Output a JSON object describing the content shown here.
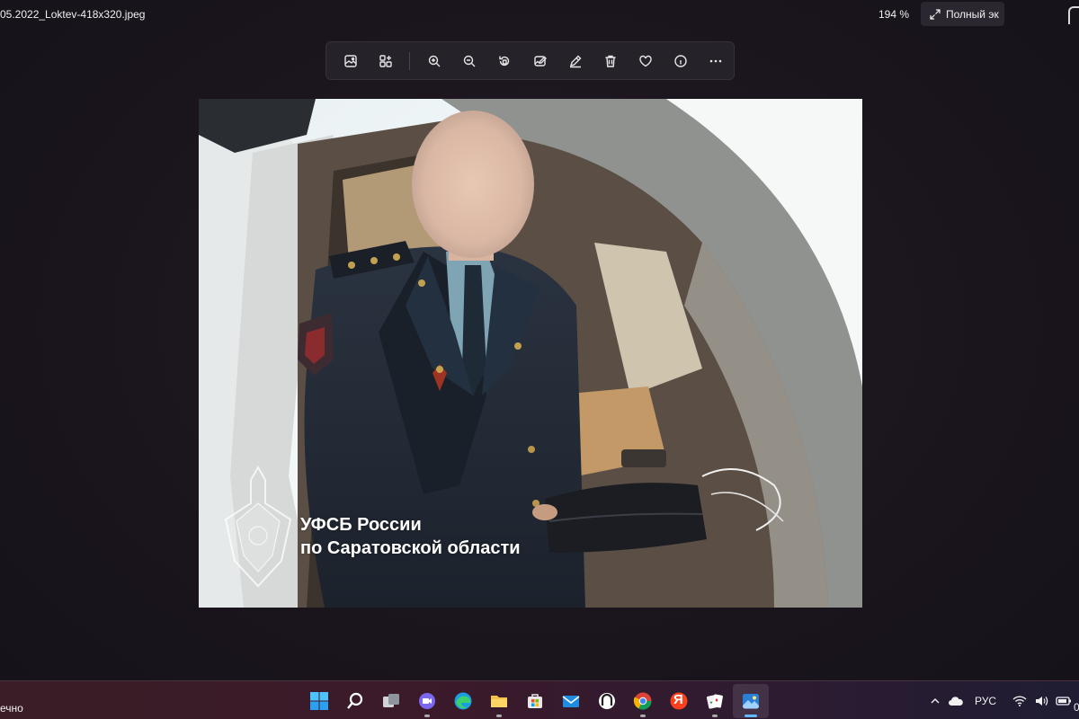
{
  "window": {
    "filename": "05.2022_Loktev-418x320.jpeg",
    "zoom": "194 %",
    "fullscreen_label": "Полный эк"
  },
  "toolbar": {
    "buttons": [
      {
        "name": "image-icon"
      },
      {
        "name": "crop-icon"
      },
      {
        "name": "zoom-in-icon"
      },
      {
        "name": "zoom-out-icon"
      },
      {
        "name": "rotate-icon"
      },
      {
        "name": "edit-image-icon"
      },
      {
        "name": "draw-icon"
      },
      {
        "name": "delete-icon"
      },
      {
        "name": "favorite-icon"
      },
      {
        "name": "info-icon"
      },
      {
        "name": "more-icon"
      }
    ]
  },
  "photo": {
    "watermark_line1": "УФСБ России",
    "watermark_line2": "по Саратовской области"
  },
  "taskbar": {
    "weather_label": "ечно",
    "apps": [
      {
        "name": "start-icon"
      },
      {
        "name": "search-icon"
      },
      {
        "name": "task-view-icon"
      },
      {
        "name": "chat-icon"
      },
      {
        "name": "edge-icon"
      },
      {
        "name": "file-explorer-icon"
      },
      {
        "name": "store-icon"
      },
      {
        "name": "mail-icon"
      },
      {
        "name": "app-icon"
      },
      {
        "name": "chrome-icon"
      },
      {
        "name": "yandex-icon",
        "label": "Я"
      },
      {
        "name": "solitaire-icon"
      },
      {
        "name": "photos-icon"
      }
    ],
    "language": "РУС",
    "clock": "0"
  },
  "colors": {
    "accent": "#63b8ff",
    "toolbar_bg": "#26222a"
  }
}
